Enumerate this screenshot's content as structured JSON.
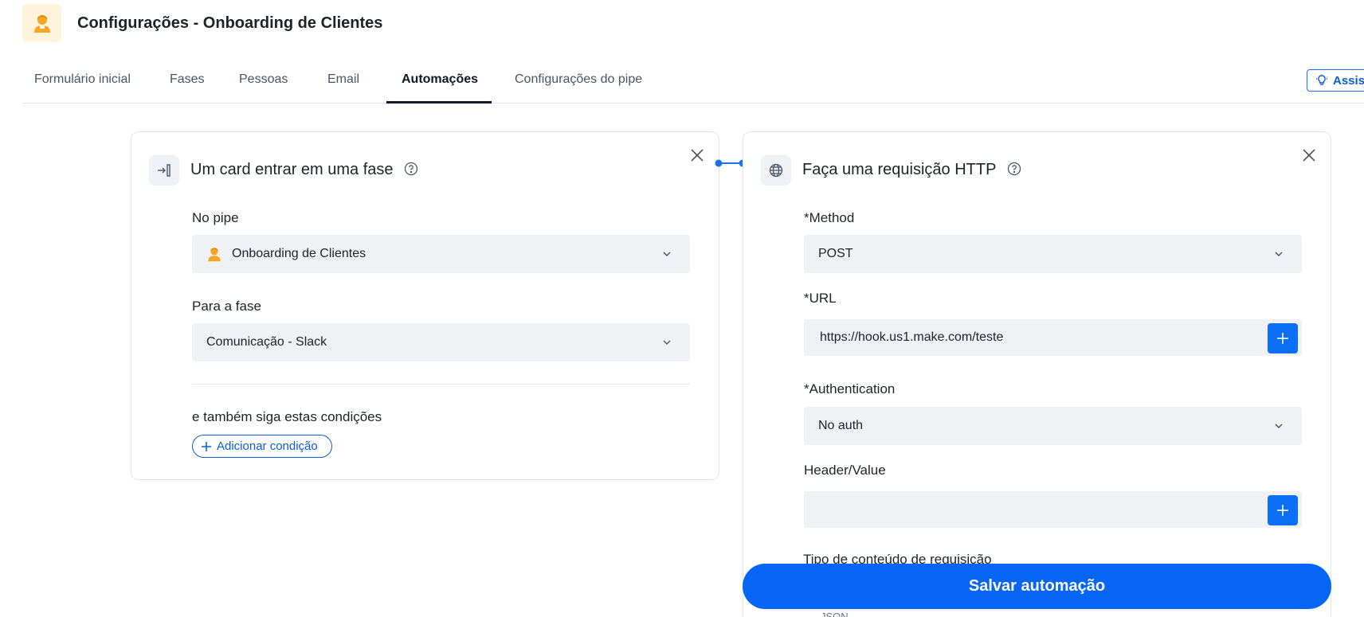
{
  "header": {
    "title": "Configurações - Onboarding de Clientes",
    "logo_icon": "user-avatar-icon"
  },
  "tabs": [
    {
      "label": "Formulário inicial",
      "active": false
    },
    {
      "label": "Fases",
      "active": false
    },
    {
      "label": "Pessoas",
      "active": false
    },
    {
      "label": "Email",
      "active": false
    },
    {
      "label": "Automações",
      "active": true
    },
    {
      "label": "Configurações do pipe",
      "active": false
    }
  ],
  "assist_button": {
    "label": "Assist",
    "icon": "lightbulb-icon"
  },
  "trigger": {
    "title": "Um card entrar em uma fase",
    "pipe_label": "No pipe",
    "pipe_value": "Onboarding de Clientes",
    "phase_label": "Para a fase",
    "phase_value": "Comunicação - Slack",
    "conditions_label": "e também siga estas condições",
    "add_condition_label": "Adicionar condição"
  },
  "action": {
    "title": "Faça uma requisição HTTP",
    "method_label": "*Method",
    "method_value": "POST",
    "url_label": "*URL",
    "url_value": "https://hook.us1.make.com/teste",
    "auth_label": "*Authentication",
    "auth_value": "No auth",
    "header_label": "Header/Value",
    "header_value": "",
    "content_type_label": "Tipo de conteúdo de requisição",
    "content_type_value": "JSON"
  },
  "save_label": "Salvar automação",
  "colors": {
    "primary": "#0665f5",
    "field_bg": "#eff1f5",
    "logo_bg": "#fff3dc",
    "avatar": "#f5a623"
  }
}
